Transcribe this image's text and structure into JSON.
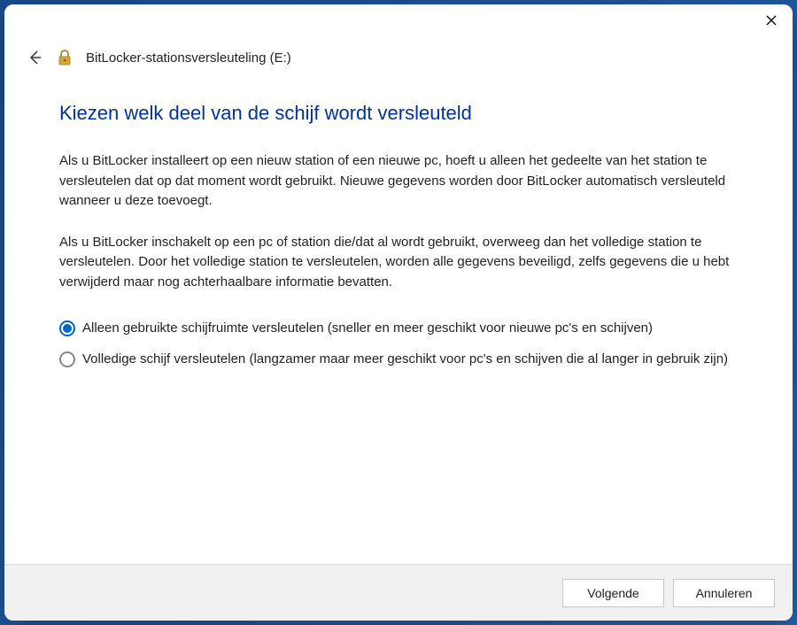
{
  "titlebar": {
    "close_label": "Close"
  },
  "header": {
    "window_title": "BitLocker-stationsversleuteling (E:)"
  },
  "page": {
    "heading": "Kiezen welk deel van de schijf wordt versleuteld",
    "para1": "Als u BitLocker installeert op een nieuw station of een nieuwe pc, hoeft u alleen het gedeelte van het station te versleutelen dat op dat moment wordt gebruikt. Nieuwe gegevens worden door BitLocker automatisch versleuteld wanneer u deze toevoegt.",
    "para2": "Als u BitLocker inschakelt op een pc of station die/dat al wordt gebruikt, overweeg dan het volledige station te versleutelen. Door het volledige station te versleutelen, worden alle gegevens beveiligd, zelfs gegevens die u hebt verwijderd maar nog achterhaalbare informatie bevatten."
  },
  "options": {
    "opt1": {
      "label": "Alleen gebruikte schijfruimte versleutelen (sneller en meer geschikt voor nieuwe pc's en schijven)",
      "selected": true
    },
    "opt2": {
      "label": "Volledige schijf versleutelen (langzamer maar meer geschikt voor pc's en schijven die al langer in gebruik zijn)",
      "selected": false
    }
  },
  "footer": {
    "next": "Volgende",
    "cancel": "Annuleren"
  }
}
